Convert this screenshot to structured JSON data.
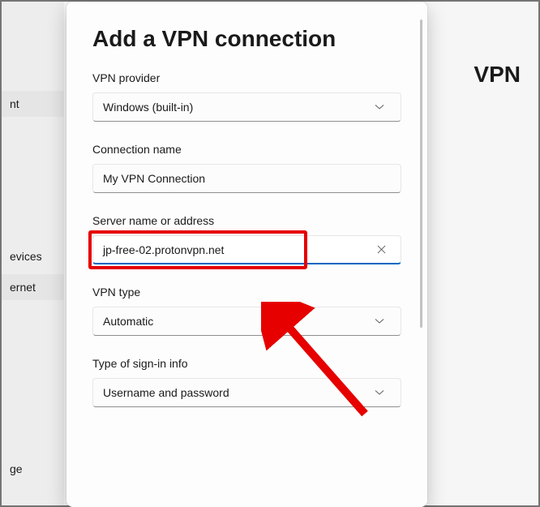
{
  "background": {
    "sidebar_partial_items": [
      "nt",
      "evices",
      "ernet",
      "ge"
    ],
    "vpn_title": "VPN"
  },
  "dialog": {
    "title": "Add a VPN connection",
    "fields": {
      "provider": {
        "label": "VPN provider",
        "value": "Windows (built-in)"
      },
      "connection_name": {
        "label": "Connection name",
        "value": "My VPN Connection"
      },
      "server": {
        "label": "Server name or address",
        "value": "jp-free-02.protonvpn.net"
      },
      "vpn_type": {
        "label": "VPN type",
        "value": "Automatic"
      },
      "signin": {
        "label": "Type of sign-in info",
        "value": "Username and password"
      }
    }
  },
  "annotations": {
    "highlight_color": "#e60000"
  }
}
